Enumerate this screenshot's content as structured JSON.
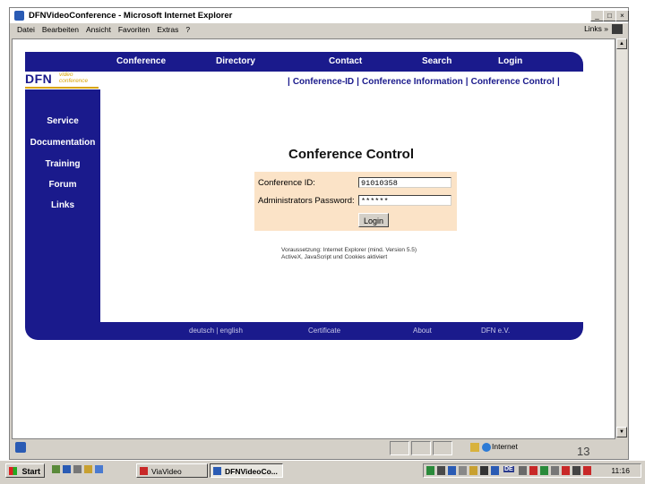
{
  "window": {
    "title": "DFNVideoConference - Microsoft Internet Explorer",
    "controls": [
      "_",
      "□",
      "×"
    ]
  },
  "menu": {
    "items": [
      "Datei",
      "Bearbeiten",
      "Ansicht",
      "Favoriten",
      "Extras",
      "?"
    ],
    "links_label": "Links »"
  },
  "site": {
    "logo": {
      "main": "DFN",
      "sub_line1": "video",
      "sub_line2": "conference"
    },
    "top_nav": [
      "Conference",
      "Directory",
      "Contact",
      "Search",
      "Login"
    ],
    "side_nav": [
      "Service",
      "Documentation",
      "Training",
      "Forum",
      "Links"
    ],
    "sub_nav": [
      "Conference-ID",
      "Conference Information",
      "Conference Control"
    ],
    "page_title": "Conference Control",
    "form": {
      "conference_id_label": "Conference ID:",
      "conference_id_value": "91010358",
      "password_label": "Administrators Password:",
      "password_value": "******",
      "login_button": "Login"
    },
    "note_line1": "Voraussetzung: Internet Explorer (mind. Version 5.5)",
    "note_line2": "ActiveX, JavaScript und Cookies aktiviert",
    "footer": [
      "deutsch | english",
      "Certificate",
      "About",
      "DFN e.V."
    ]
  },
  "status": {
    "zone": "Internet"
  },
  "slide_number": "13",
  "taskbar": {
    "start_label": "Start",
    "tasks": [
      "ViaVideo",
      "DFNVideoCo..."
    ],
    "clock": "11:16",
    "tray_language": "DE"
  },
  "colors": {
    "site_navy": "#1a1a8c",
    "form_background": "#fbe3c7",
    "logo_gold": "#d9a400"
  }
}
